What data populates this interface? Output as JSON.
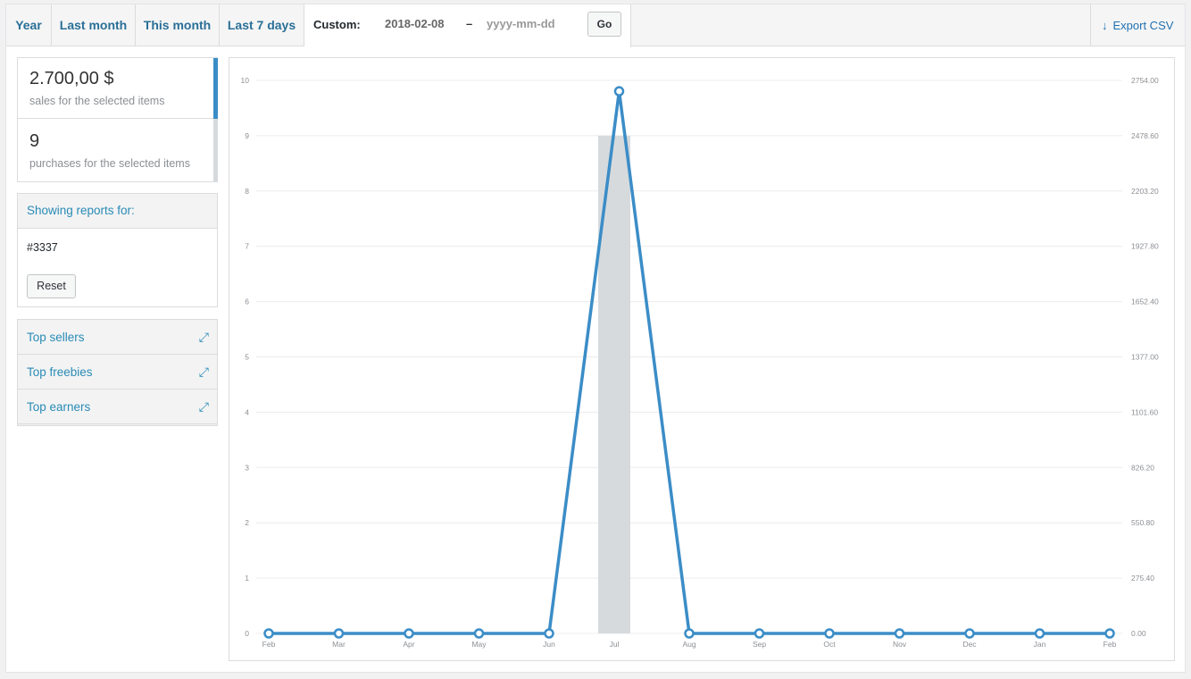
{
  "tabs": [
    {
      "label": "Year",
      "left": 0,
      "width": 51
    },
    {
      "label": "Last month",
      "left": 51,
      "width": 94
    },
    {
      "label": "This month",
      "left": 145,
      "width": 94
    },
    {
      "label": "Last 7 days",
      "left": 239,
      "width": 95
    }
  ],
  "custom": {
    "label": "Custom:",
    "from_value": "2018-02-08",
    "to_placeholder": "yyyy-mm-dd",
    "separator": "–",
    "go_label": "Go"
  },
  "export": {
    "label": "Export CSV",
    "icon": "download-arrow-icon"
  },
  "kpis": [
    {
      "value": "2.700,00 $",
      "label": "sales for the selected items"
    },
    {
      "value": "9",
      "label": "purchases for the selected items"
    }
  ],
  "report": {
    "heading": "Showing reports for:",
    "item": "#3337",
    "reset_label": "Reset"
  },
  "widgets": [
    {
      "label": "Top sellers",
      "icon": "expand-icon"
    },
    {
      "label": "Top freebies",
      "icon": "expand-icon"
    },
    {
      "label": "Top earners",
      "icon": "expand-icon"
    }
  ],
  "colors": {
    "line": "#3b8dc7",
    "bar": "#d7dadd",
    "grid": "#ececec",
    "tick": "#8c8f94"
  },
  "chart_data": {
    "type": "bar+line",
    "categories": [
      "Feb",
      "Mar",
      "Apr",
      "May",
      "Jun",
      "Jul",
      "Aug",
      "Sep",
      "Oct",
      "Nov",
      "Dec",
      "Jan",
      "Feb"
    ],
    "series": [
      {
        "kind": "bar",
        "axis": "left",
        "values": [
          0,
          0,
          0,
          0,
          0,
          9,
          0,
          0,
          0,
          0,
          0,
          0,
          0
        ]
      },
      {
        "kind": "line",
        "axis": "right",
        "values": [
          0,
          0,
          0,
          0,
          0,
          2700,
          0,
          0,
          0,
          0,
          0,
          0,
          0
        ]
      }
    ],
    "left_ylim": [
      0,
      10
    ],
    "left_ticks": [
      "0",
      "1",
      "2",
      "3",
      "4",
      "5",
      "6",
      "7",
      "8",
      "9",
      "10"
    ],
    "right_ylim": [
      0,
      2754
    ],
    "right_ticks": [
      "0.00",
      "275.40",
      "550.80",
      "826.20",
      "1101.60",
      "1377.00",
      "1652.40",
      "1927.80",
      "2203.20",
      "2478.60",
      "2754.00"
    ],
    "grid": true
  }
}
